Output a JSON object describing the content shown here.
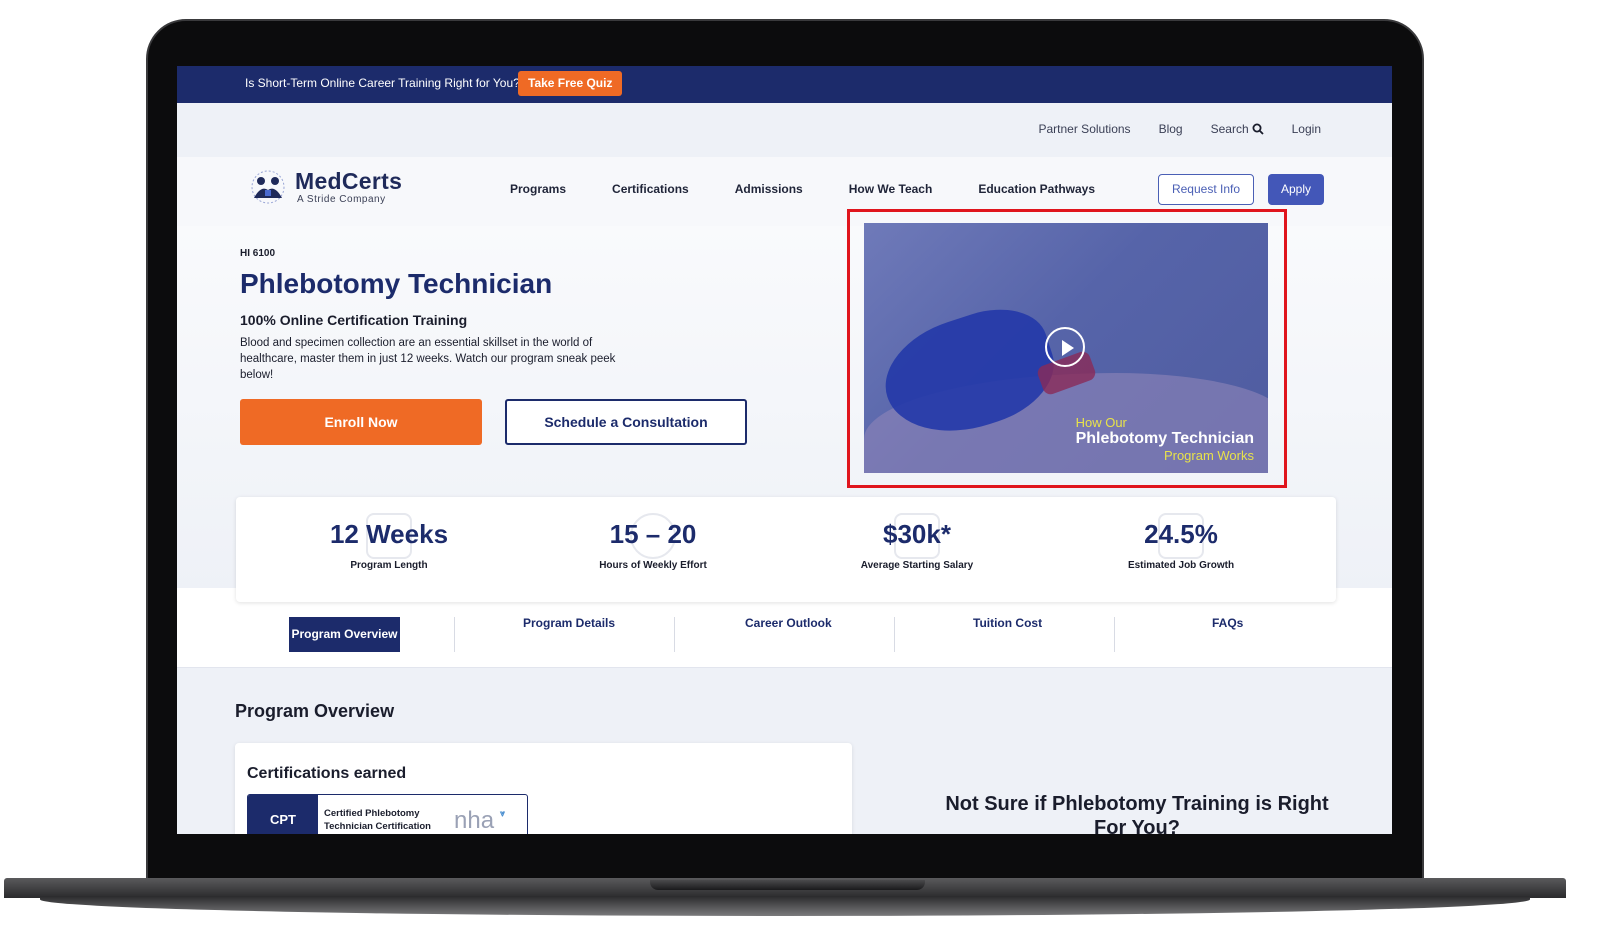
{
  "promo": {
    "text": "Is Short-Term Online Career Training Right for You?",
    "button": "Take Free Quiz"
  },
  "util_nav": {
    "partner": "Partner Solutions",
    "blog": "Blog",
    "search": "Search",
    "login": "Login"
  },
  "logo": {
    "name": "MedCerts",
    "tagline": "A Stride Company"
  },
  "main_nav": [
    "Programs",
    "Certifications",
    "Admissions",
    "How We Teach",
    "Education Pathways"
  ],
  "header_buttons": {
    "request": "Request Info",
    "apply": "Apply"
  },
  "hero": {
    "code": "HI 6100",
    "title": "Phlebotomy Technician",
    "subtitle": "100% Online Certification Training",
    "description": "Blood and specimen collection are an essential skillset in the world of healthcare, master them in just 12 weeks. Watch our program sneak peek below!",
    "enroll": "Enroll Now",
    "schedule": "Schedule a Consultation"
  },
  "video": {
    "line1": "How Our",
    "line2": "Phlebotomy Technician",
    "line3": "Program Works",
    "icon": "play-icon"
  },
  "stats": [
    {
      "value": "12 Weeks",
      "label": "Program Length"
    },
    {
      "value": "15 – 20",
      "label": "Hours of Weekly Effort"
    },
    {
      "value": "$30k*",
      "label": "Average Starting Salary"
    },
    {
      "value": "24.5%",
      "label": "Estimated Job Growth"
    }
  ],
  "tabs": [
    "Program Overview",
    "Program Details",
    "Career Outlook",
    "Tuition Cost",
    "FAQs"
  ],
  "overview": {
    "title": "Program Overview",
    "cert_heading": "Certifications earned",
    "cert_code": "CPT",
    "cert_name": "Certified Phlebotomy Technician Certification",
    "cert_org": "nha",
    "side_question": "Not Sure if Phlebotomy Training is Right For You?"
  },
  "colors": {
    "navy": "#1c2b6b",
    "orange": "#ef6a25",
    "accent_blue": "#4357b8",
    "highlight_red": "#e0151d"
  }
}
